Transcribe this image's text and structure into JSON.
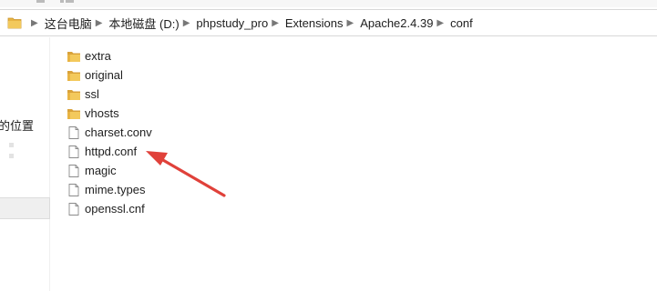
{
  "breadcrumb": [
    {
      "label": "这台电脑"
    },
    {
      "label": "本地磁盘 (D:)"
    },
    {
      "label": "phpstudy_pro"
    },
    {
      "label": "Extensions"
    },
    {
      "label": "Apache2.4.39"
    },
    {
      "label": "conf"
    }
  ],
  "nav_pane": {
    "partial_label": "的位置"
  },
  "files": [
    {
      "name": "extra",
      "type": "folder"
    },
    {
      "name": "original",
      "type": "folder"
    },
    {
      "name": "ssl",
      "type": "folder"
    },
    {
      "name": "vhosts",
      "type": "folder"
    },
    {
      "name": "charset.conv",
      "type": "file"
    },
    {
      "name": "httpd.conf",
      "type": "file"
    },
    {
      "name": "magic",
      "type": "file"
    },
    {
      "name": "mime.types",
      "type": "file"
    },
    {
      "name": "openssl.cnf",
      "type": "file"
    }
  ],
  "colors": {
    "folder_yellow": "#e8b443",
    "arrow_red": "#e0413a"
  },
  "icons": {
    "folder": "folder-icon",
    "file": "file-icon",
    "separator": "chevron-right-icon",
    "annotation": "red-arrow-annotation"
  }
}
